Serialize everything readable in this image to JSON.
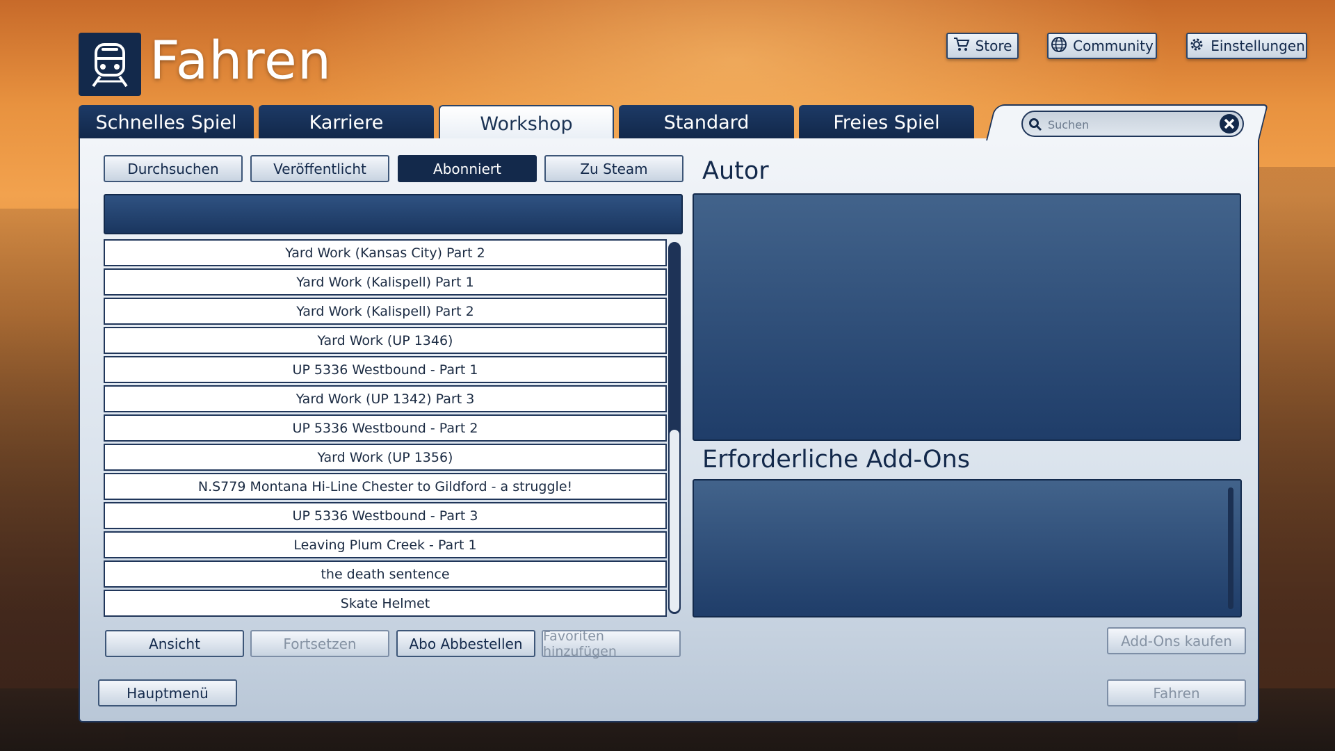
{
  "header": {
    "title": "Fahren",
    "top_buttons": [
      {
        "label": "Store",
        "icon": "cart-icon"
      },
      {
        "label": "Community",
        "icon": "globe-icon"
      },
      {
        "label": "Einstellungen",
        "icon": "gear-icon"
      }
    ]
  },
  "tabs": [
    "Schnelles Spiel",
    "Karriere",
    "Workshop",
    "Standard",
    "Freies Spiel"
  ],
  "active_tab": "Workshop",
  "search": {
    "placeholder": "Suchen"
  },
  "sub_tabs": [
    "Durchsuchen",
    "Veröffentlicht",
    "Abonniert",
    "Zu Steam"
  ],
  "active_sub_tab": "Abonniert",
  "list_items": [
    "Yard Work (Kansas City) Part 2",
    "Yard Work (Kalispell) Part 1",
    "Yard Work (Kalispell) Part 2",
    "Yard Work (UP 1346)",
    "UP 5336 Westbound - Part 1",
    "Yard Work (UP 1342) Part 3",
    "UP 5336 Westbound - Part 2",
    "Yard Work (UP 1356)",
    "N.S779 Montana Hi-Line Chester to Gildford - a struggle!",
    "UP 5336 Westbound - Part 3",
    "Leaving Plum Creek - Part 1",
    "the death sentence",
    "Skate Helmet"
  ],
  "list_actions": {
    "view": "Ansicht",
    "continue": "Fortsetzen",
    "unsubscribe": "Abo Abbestellen",
    "favorite": "Favoriten hinzufügen"
  },
  "right_panel": {
    "author_label": "Autor",
    "addons_label": "Erforderliche Add-Ons",
    "buy_addons": "Add-Ons kaufen",
    "drive": "Fahren"
  },
  "main_menu": "Hauptmenü"
}
